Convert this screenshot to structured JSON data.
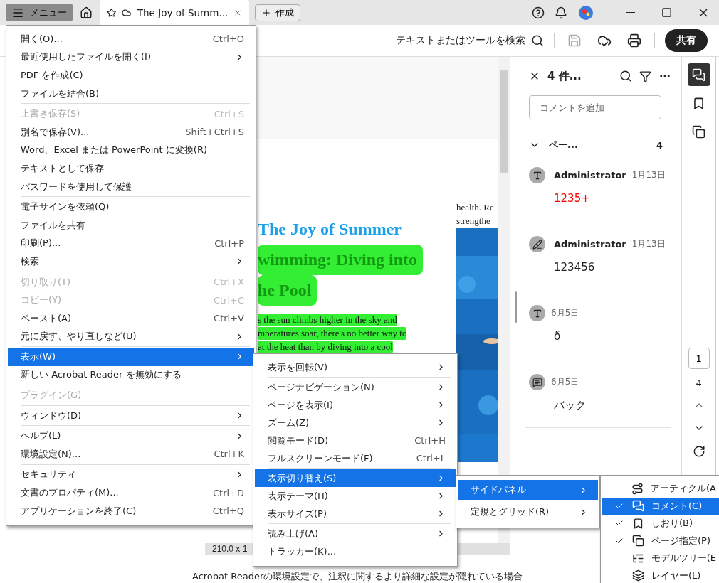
{
  "title_bar": {
    "menu_button": "メニュー",
    "tab": {
      "title": "The Joy of Summ...",
      "selected": true
    },
    "create_button": "作成"
  },
  "toolbar": {
    "search_label": "テキストまたはツールを検索",
    "share_button": "共有"
  },
  "document": {
    "heading": [
      {
        "text": "The Joy of Summer",
        "highlighted": false
      },
      {
        "text": "wimming: Diving into",
        "highlighted": true
      },
      {
        "text": "he Pool",
        "highlighted": true
      }
    ],
    "body_lines": [
      "s the sun climbs higher in the sky and",
      "mperatures soar, there's no better way to",
      "at the heat than by diving into a cool"
    ],
    "side_lines": [
      "health. Re",
      "strengthe"
    ],
    "status": "210.0 x 1"
  },
  "footer_text": "Acrobat Readerの環境設定で、注釈に関するより詳細な設定が隠れている場合",
  "comments_panel": {
    "title": "4 件...",
    "add_placeholder": "コメントを追加",
    "group": {
      "label": "ペー...",
      "count": "4",
      "expanded": true
    },
    "comments": [
      {
        "kind": "text",
        "author": "Administrator",
        "date": "1月13日",
        "text": "1235+",
        "color": "#ff0000"
      },
      {
        "kind": "pen",
        "author": "Administrator",
        "date": "1月13日",
        "text": "123456",
        "color": "#222222"
      },
      {
        "kind": "typewriter",
        "date": "6月5日",
        "text": "ð",
        "color": "#222222"
      },
      {
        "kind": "textbox",
        "date": "6月5日",
        "text": "バック",
        "color": "#222222"
      }
    ]
  },
  "rail": {
    "tools": [
      {
        "kind": "comment",
        "selected": true
      },
      {
        "kind": "bookmark",
        "selected": false
      },
      {
        "kind": "pages",
        "selected": false
      }
    ],
    "page_number": "1",
    "page_count": "4"
  },
  "main_menu": {
    "groups": [
      [
        {
          "label": "開く(O)...",
          "shortcut": "Ctrl+O",
          "submenu": false,
          "disabled": false,
          "selected": false
        },
        {
          "label": "最近使用したファイルを開く(I)",
          "submenu": true,
          "disabled": false,
          "selected": false
        },
        {
          "label": "PDF を作成(C)",
          "submenu": false,
          "disabled": false,
          "selected": false
        },
        {
          "label": "ファイルを結合(B)",
          "submenu": false,
          "disabled": false,
          "selected": false
        }
      ],
      [
        {
          "label": "上書き保存(S)",
          "shortcut": "Ctrl+S",
          "submenu": false,
          "disabled": true,
          "selected": false
        },
        {
          "label": "別名で保存(V)...",
          "shortcut": "Shift+Ctrl+S",
          "submenu": false,
          "disabled": false,
          "selected": false
        },
        {
          "label": "Word、Excel または PowerPoint に変換(R)",
          "submenu": false,
          "disabled": false,
          "selected": false
        },
        {
          "label": "テキストとして保存",
          "submenu": false,
          "disabled": false,
          "selected": false
        },
        {
          "label": "パスワードを使用して保護",
          "submenu": false,
          "disabled": false,
          "selected": false
        }
      ],
      [
        {
          "label": "電子サインを依頼(Q)",
          "submenu": false,
          "disabled": false,
          "selected": false
        },
        {
          "label": "ファイルを共有",
          "submenu": false,
          "disabled": false,
          "selected": false
        },
        {
          "label": "印刷(P)...",
          "shortcut": "Ctrl+P",
          "submenu": false,
          "disabled": false,
          "selected": false
        },
        {
          "label": "検索",
          "submenu": true,
          "disabled": false,
          "selected": false
        }
      ],
      [
        {
          "label": "切り取り(T)",
          "shortcut": "Ctrl+X",
          "submenu": false,
          "disabled": true,
          "selected": false
        },
        {
          "label": "コピー(Y)",
          "shortcut": "Ctrl+C",
          "submenu": false,
          "disabled": true,
          "selected": false
        },
        {
          "label": "ペースト(A)",
          "shortcut": "Ctrl+V",
          "submenu": false,
          "disabled": false,
          "selected": false
        },
        {
          "label": "元に戻す、やり直しなど(U)",
          "submenu": true,
          "disabled": false,
          "selected": false
        }
      ],
      [
        {
          "label": "表示(W)",
          "submenu": true,
          "disabled": false,
          "selected": true
        },
        {
          "label": "新しい Acrobat Reader を無効にする",
          "submenu": false,
          "disabled": false,
          "selected": false
        }
      ],
      [
        {
          "label": "プラグイン(G)",
          "submenu": false,
          "disabled": true,
          "selected": false
        }
      ],
      [
        {
          "label": "ウィンドウ(D)",
          "submenu": true,
          "disabled": false,
          "selected": false
        }
      ],
      [
        {
          "label": "ヘルプ(L)",
          "submenu": true,
          "disabled": false,
          "selected": false
        },
        {
          "label": "環境設定(N)...",
          "shortcut": "Ctrl+K",
          "submenu": false,
          "disabled": false,
          "selected": false
        }
      ],
      [
        {
          "label": "セキュリティ",
          "submenu": true,
          "disabled": false,
          "selected": false
        },
        {
          "label": "文書のプロパティ(M)...",
          "shortcut": "Ctrl+D",
          "submenu": false,
          "disabled": false,
          "selected": false
        },
        {
          "label": "アプリケーションを終了(C)",
          "shortcut": "Ctrl+Q",
          "submenu": false,
          "disabled": false,
          "selected": false
        }
      ]
    ]
  },
  "view_menu": {
    "groups": [
      [
        {
          "label": "表示を回転(V)",
          "submenu": true,
          "disabled": false,
          "selected": false
        }
      ],
      [
        {
          "label": "ページナビゲーション(N)",
          "submenu": true,
          "disabled": false,
          "selected": false
        },
        {
          "label": "ページを表示(I)",
          "submenu": true,
          "disabled": false,
          "selected": false
        },
        {
          "label": "ズーム(Z)",
          "submenu": true,
          "disabled": false,
          "selected": false
        },
        {
          "label": "閲覧モード(D)",
          "shortcut": "Ctrl+H",
          "submenu": false,
          "disabled": false,
          "selected": false
        },
        {
          "label": "フルスクリーンモード(F)",
          "shortcut": "Ctrl+L",
          "submenu": false,
          "disabled": false,
          "selected": false
        }
      ],
      [
        {
          "label": "表示切り替え(S)",
          "submenu": true,
          "disabled": false,
          "selected": true
        },
        {
          "label": "表示テーマ(H)",
          "submenu": true,
          "disabled": false,
          "selected": false
        },
        {
          "label": "表示サイズ(P)",
          "submenu": true,
          "disabled": false,
          "selected": false
        }
      ],
      [
        {
          "label": "読み上げ(A)",
          "submenu": true,
          "disabled": false,
          "selected": false
        },
        {
          "label": "トラッカー(K)...",
          "submenu": false,
          "disabled": false,
          "selected": false
        }
      ]
    ]
  },
  "toggle_menu": {
    "groups": [
      [
        {
          "label": "サイドパネル",
          "submenu": true,
          "disabled": false,
          "selected": true
        }
      ],
      [
        {
          "label": "定規とグリッド(R)",
          "submenu": true,
          "disabled": false,
          "selected": false
        }
      ]
    ]
  },
  "side_panel_menu": {
    "items": [
      {
        "kind": "article",
        "label": "アーティクル(A",
        "checked": false,
        "selected": false
      },
      {
        "kind": "comment",
        "label": "コメント(C)",
        "checked": true,
        "selected": true
      },
      {
        "kind": "bookmark",
        "label": "しおり(B)",
        "checked": true,
        "selected": false
      },
      {
        "kind": "pages",
        "label": "ページ指定(P)",
        "checked": true,
        "selected": false
      },
      {
        "kind": "tree",
        "label": "モデルツリー(E",
        "checked": false,
        "selected": false
      },
      {
        "kind": "layers",
        "label": "レイヤー(L)",
        "checked": false,
        "selected": false
      }
    ]
  }
}
